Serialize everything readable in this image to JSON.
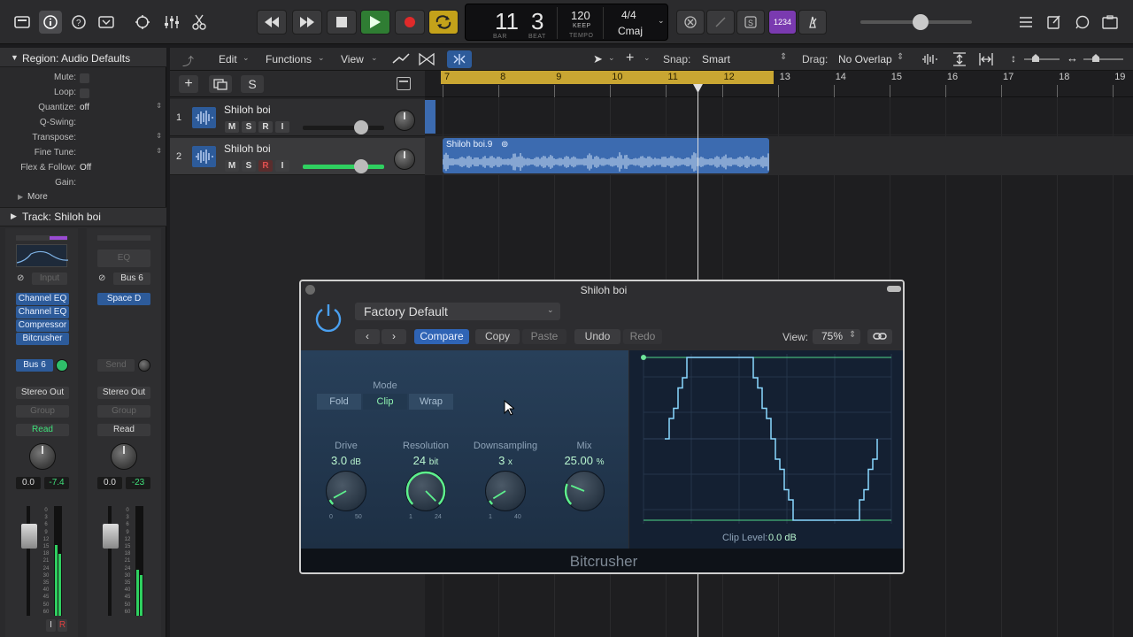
{
  "transport": {
    "bar": "11",
    "beat": "3",
    "bar_label": "BAR",
    "beat_label": "BEAT",
    "tempo": "120",
    "keep": "KEEP",
    "tempo_label": "TEMPO",
    "signature": "4/4",
    "key": "Cmaj",
    "count_in": "1234"
  },
  "inspector": {
    "region_title": "Region: Audio Defaults",
    "rows": [
      {
        "label": "Mute:",
        "value": ""
      },
      {
        "label": "Loop:",
        "value": ""
      },
      {
        "label": "Quantize:",
        "value": "off"
      },
      {
        "label": "Q-Swing:",
        "value": ""
      },
      {
        "label": "Transpose:",
        "value": ""
      },
      {
        "label": "Fine Tune:",
        "value": ""
      },
      {
        "label": "Flex & Follow:",
        "value": "Off"
      },
      {
        "label": "Gain:",
        "value": ""
      }
    ],
    "more": "More",
    "track_title": "Track: Shiloh boi",
    "strip1": {
      "input": "Input",
      "plugins": [
        "Channel EQ",
        "Channel EQ",
        "Compressor",
        "Bitcrusher"
      ],
      "send": "Bus 6",
      "output": "Stereo Out",
      "group": "Group",
      "automation": "Read",
      "vol": "0.0",
      "peak": "-7.4",
      "scale": [
        "0",
        "3",
        "6",
        "9",
        "12",
        "15",
        "18",
        "21",
        "24",
        "30",
        "35",
        "40",
        "45",
        "50",
        "60"
      ],
      "ir": "I",
      "rec": "R"
    },
    "strip2": {
      "eq": "EQ",
      "input": "Bus 6",
      "plugin": "Space D",
      "send": "Send",
      "output": "Stereo Out",
      "group": "Group",
      "automation": "Read",
      "vol": "0.0",
      "peak": "-23"
    }
  },
  "toolbar": {
    "edit": "Edit",
    "functions": "Functions",
    "view": "View",
    "snap_label": "Snap:",
    "snap": "Smart",
    "drag_label": "Drag:",
    "drag": "No Overlap"
  },
  "tracks": [
    {
      "num": "1",
      "name": "Shiloh boi"
    },
    {
      "num": "2",
      "name": "Shiloh boi"
    }
  ],
  "msri": [
    "M",
    "S",
    "R",
    "I"
  ],
  "ruler": [
    "7",
    "8",
    "9",
    "10",
    "11",
    "12",
    "13",
    "14",
    "15",
    "16",
    "17",
    "18",
    "19"
  ],
  "region": {
    "name": "Shiloh boi.9"
  },
  "plugin": {
    "title": "Shiloh boi",
    "preset": "Factory Default",
    "compare": "Compare",
    "copy": "Copy",
    "paste": "Paste",
    "undo": "Undo",
    "redo": "Redo",
    "view_label": "View:",
    "view": "75%",
    "mode_label": "Mode",
    "modes": [
      "Fold",
      "Clip",
      "Wrap"
    ],
    "params": [
      {
        "label": "Drive",
        "value": "3.0",
        "unit": "dB",
        "min": "0",
        "max": "50",
        "fraction": 0.06
      },
      {
        "label": "Resolution",
        "value": "24",
        "unit": "bit",
        "min": "1",
        "max": "24",
        "fraction": 1.0
      },
      {
        "label": "Downsampling",
        "value": "3",
        "unit": "x",
        "min": "1",
        "max": "40",
        "fraction": 0.05
      },
      {
        "label": "Mix",
        "value": "25.00",
        "unit": "%",
        "min": "",
        "max": "",
        "fraction": 0.25
      }
    ],
    "clip_label": "Clip Level:",
    "clip_value": "0.0 dB",
    "name": "Bitcrusher"
  }
}
